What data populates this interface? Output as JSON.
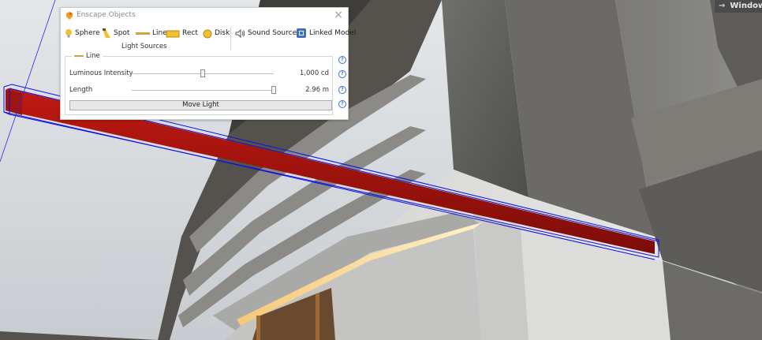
{
  "window_label": {
    "arrow": "→",
    "text": "Window"
  },
  "panel": {
    "title": "Enscape Objects",
    "close_glyph": "×",
    "toolbar": {
      "sphere": "Sphere",
      "spot": "Spot",
      "line": "Line",
      "rect": "Rect",
      "disk": "Disk",
      "sound_source": "Sound Source",
      "linked_model": "Linked Model",
      "group_label": "Light Sources"
    },
    "properties": {
      "section_title": "Line",
      "rows": [
        {
          "label": "Luminous Intensity",
          "value": "1,000 cd",
          "slider_level": 0.5
        },
        {
          "label": "Length",
          "value": "2.96 m",
          "slider_level": 1.0
        }
      ],
      "move_button": "Move Light",
      "help_glyph": "?"
    }
  },
  "colors": {
    "accent_yellow": "#e8b52c",
    "line_light_red": "#a8130f",
    "selection_blue": "#1010e0",
    "help_blue": "#3a6fd0"
  },
  "icons": [
    "enscape-logo-icon",
    "sphere-light-icon",
    "spot-light-icon",
    "line-light-icon",
    "rect-light-icon",
    "disk-light-icon",
    "sound-source-icon",
    "linked-model-icon",
    "help-icon"
  ]
}
